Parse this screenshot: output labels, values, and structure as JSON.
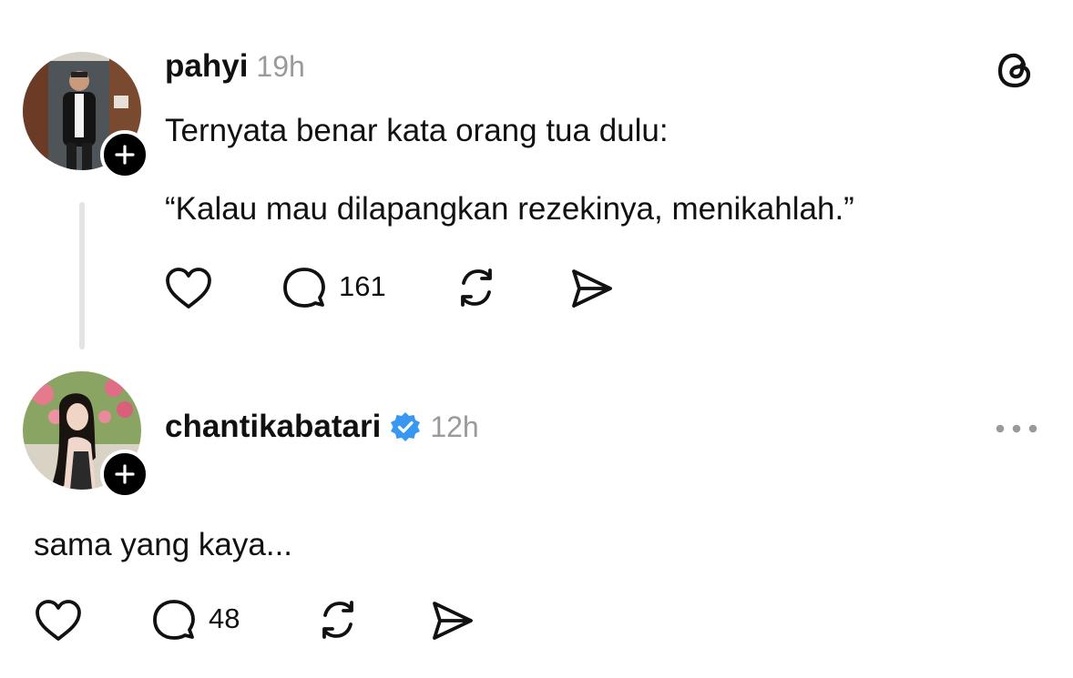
{
  "app": {
    "logo_icon": "threads-logo-icon"
  },
  "posts": [
    {
      "username": "pahyi",
      "time": "19h",
      "text_lines": [
        "Ternyata benar kata orang tua dulu:",
        "“Kalau mau dilapangkan rezekinya, menikahlah.”"
      ],
      "actions": {
        "like_icon": "heart-icon",
        "reply_icon": "comment-icon",
        "reply_count": "161",
        "repost_icon": "repost-icon",
        "share_icon": "send-icon"
      }
    },
    {
      "username": "chantikabatari",
      "verified": true,
      "time": "12h",
      "more_icon": "more-horizontal-icon",
      "text_lines": [
        "sama yang kaya..."
      ],
      "actions": {
        "like_icon": "heart-icon",
        "reply_icon": "comment-icon",
        "reply_count": "48",
        "repost_icon": "repost-icon",
        "share_icon": "send-icon"
      }
    }
  ],
  "colors": {
    "verified": "#3897f0",
    "muted": "#9a9a9a",
    "thread_line": "#e4e4e4"
  }
}
